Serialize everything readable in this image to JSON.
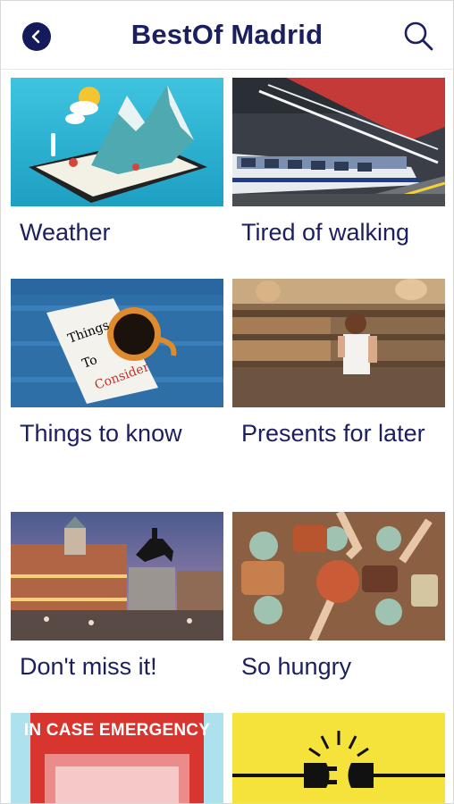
{
  "header": {
    "title": "BestOf Madrid"
  },
  "categories": [
    {
      "label": "Weather",
      "image": "weather-tablet-illustration"
    },
    {
      "label": "Tired of walking",
      "image": "metro-train"
    },
    {
      "label": "Things to know",
      "image": "things-to-consider-note-and-coffee"
    },
    {
      "label": "Presents for later",
      "image": "market-shop"
    },
    {
      "label": "Don't miss it!",
      "image": "puerta-del-sol-statue"
    },
    {
      "label": "So hungry",
      "image": "food-table"
    },
    {
      "label": "",
      "image": "emergency-box",
      "image_text": "IN CASE EMERGENCY"
    },
    {
      "label": "",
      "image": "unplugged-plug"
    }
  ],
  "image_texts": {
    "things_note_1": "Things",
    "things_note_2": "To",
    "things_note_3": "Consider"
  },
  "colors": {
    "brand_navy": "#1b1f5f",
    "back_button": "#141a5a"
  }
}
